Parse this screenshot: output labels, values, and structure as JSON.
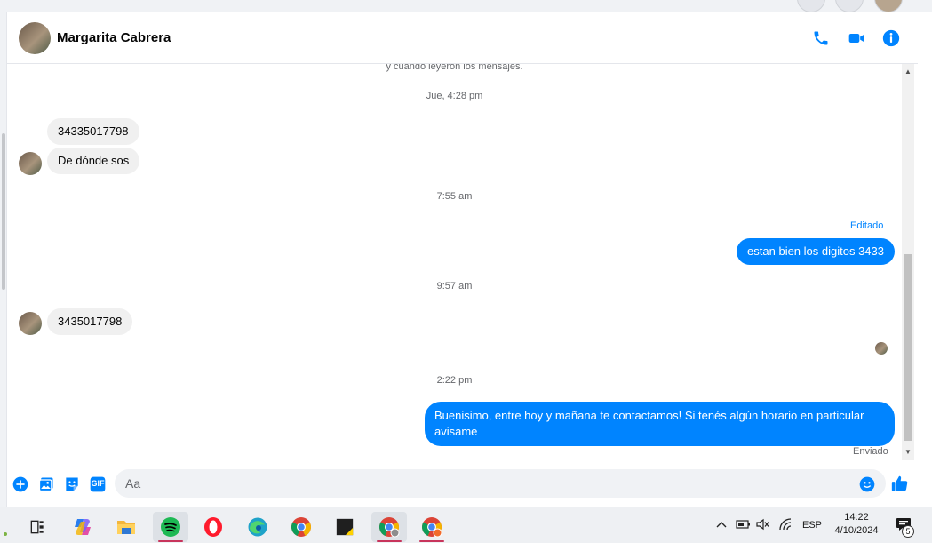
{
  "contact": {
    "name": "Margarita Cabrera"
  },
  "chat": {
    "notice": "y cuándo leyeron los mensajes.",
    "time_1": "Jue, 4:28 pm",
    "msg_1": "34335017798",
    "msg_2": "De dónde sos",
    "time_2": "7:55 am",
    "edited_label": "Editado",
    "msg_3": "estan bien los digitos 3433",
    "time_3": "9:57 am",
    "msg_4": "3435017798",
    "time_4": "2:22 pm",
    "msg_5_line1": "Buenisimo, entre hoy y mañana te contactamos! Si tenés algún horario en particular",
    "msg_5_line2": "avisame",
    "sent_label": "Enviado"
  },
  "composer": {
    "placeholder": "Aa",
    "gif_label": "GIF"
  },
  "icons": {
    "header": [
      "phone-icon",
      "video-camera-icon",
      "info-icon"
    ],
    "composer": [
      "add-icon",
      "photo-icon",
      "sticker-icon",
      "gif-icon",
      "emoji-icon",
      "like-icon"
    ]
  },
  "taskbar": {
    "apps": [
      "task-view",
      "copilot",
      "file-explorer",
      "spotify",
      "opera",
      "edge",
      "chrome",
      "sticky-notes",
      "chrome-profile",
      "chrome-profile-2"
    ],
    "language": "ESP",
    "time": "14:22",
    "date": "4/10/2024",
    "notification_count": "5"
  },
  "colors": {
    "accent": "#0084ff",
    "incoming_bubble": "#f0f0f0",
    "muted_text": "#65676b"
  }
}
